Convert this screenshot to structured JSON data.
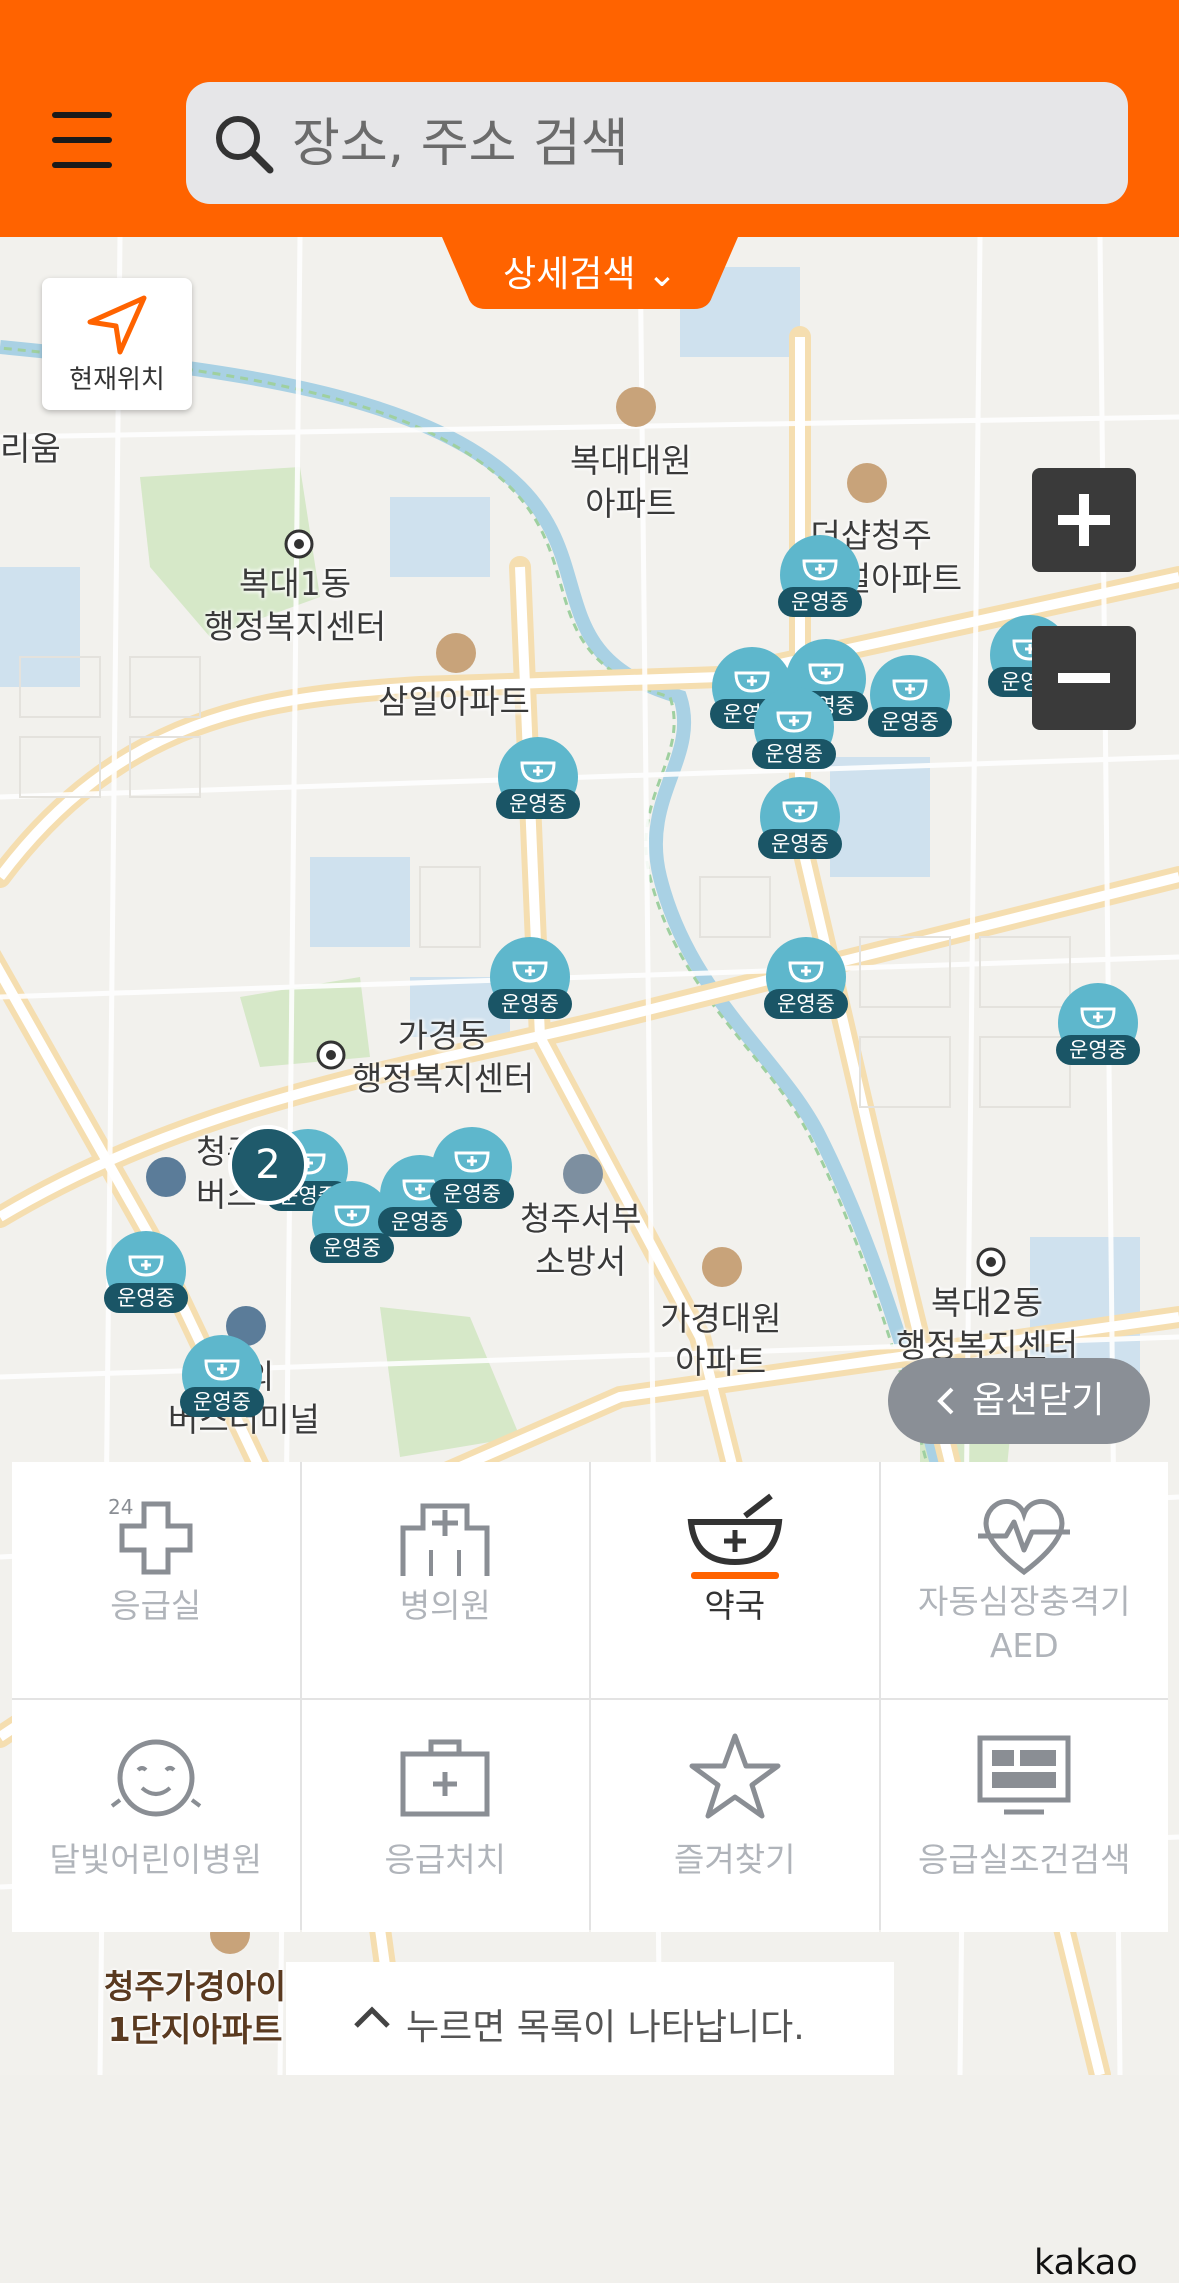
{
  "header": {
    "search_placeholder": "장소, 주소 검색",
    "advanced_search_label": "상세검색 ⌄"
  },
  "map": {
    "current_location_label": "현재위치",
    "zoom_in_label": "+",
    "zoom_out_label": "−",
    "pin_status": "운영중",
    "cluster_count": "2",
    "labels": {
      "l1": "리움",
      "l2": "복대대원\n아파트",
      "l3": "더샵청주\n센트럴아파트",
      "l4": "복대1동\n행정복지센터",
      "l5": "삼일아파트",
      "l6": "가경동\n행정복지센터",
      "l7": "청주\n버스",
      "l8": "청주서부\n소방서",
      "l9": "가경대원\n아파트",
      "l10": "복대2동\n행정복지센터",
      "l11": "시외\n버스터미널",
      "l12": "청주가경아이\n1단지아파트"
    },
    "attribution": "kakao"
  },
  "options_close_label": "옵션닫기",
  "categories": [
    {
      "label": "응급실",
      "icon": "emergency-24-icon"
    },
    {
      "label": "병의원",
      "icon": "hospital-icon"
    },
    {
      "label": "약국",
      "icon": "pharmacy-icon",
      "active": true
    },
    {
      "label": "자동심장충격기\nAED",
      "icon": "heart-aed-icon"
    },
    {
      "label": "달빛어린이병원",
      "icon": "child-face-icon"
    },
    {
      "label": "응급처치",
      "icon": "first-aid-kit-icon"
    },
    {
      "label": "즐겨찾기",
      "icon": "star-icon"
    },
    {
      "label": "응급실조건검색",
      "icon": "monitor-icon"
    }
  ],
  "list_hint": "누르면 목록이 나타납니다.",
  "colors": {
    "header": "#ff6300",
    "pin": "#5eb7cc",
    "pin_badge": "#1a5566",
    "active_underline": "#ff6300"
  }
}
